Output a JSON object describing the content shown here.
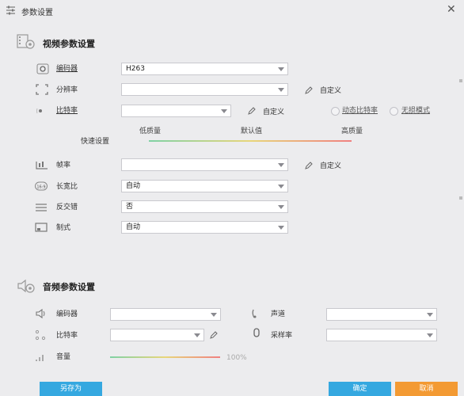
{
  "window": {
    "title": "参数设置"
  },
  "video": {
    "section_title": "视频参数设置",
    "encoder": {
      "label": "编码器",
      "value": "H263"
    },
    "resolution": {
      "label": "分辨率",
      "value": "",
      "custom_label": "自定义"
    },
    "bitrate": {
      "label": "比特率",
      "value": "",
      "custom_label": "自定义",
      "dynamic_label": "动态比特率",
      "lossless_label": "无损模式"
    },
    "quick": {
      "label": "快速设置",
      "low": "低质量",
      "default": "默认值",
      "high": "高质量"
    },
    "framerate": {
      "label": "帧率",
      "value": "",
      "custom_label": "自定义"
    },
    "aspect": {
      "label": "长宽比",
      "value": "自动"
    },
    "deinterlace": {
      "label": "反交错",
      "value": "否"
    },
    "crop": {
      "label": "制式",
      "value": "自动"
    }
  },
  "audio": {
    "section_title": "音频参数设置",
    "encoder": {
      "label": "编码器",
      "value": ""
    },
    "channels": {
      "label": "声道",
      "value": ""
    },
    "bitrate": {
      "label": "比特率",
      "value": ""
    },
    "samplerate": {
      "label": "采样率",
      "value": ""
    },
    "volume": {
      "label": "音量",
      "value": "100%"
    }
  },
  "buttons": {
    "save_as": "另存为",
    "ok": "确定",
    "cancel": "取消"
  },
  "colors": {
    "primary": "#35a8e0",
    "cancel": "#f39a33",
    "accent_gradient": [
      "#7fd1a4",
      "#e8d67a",
      "#f08080"
    ]
  }
}
